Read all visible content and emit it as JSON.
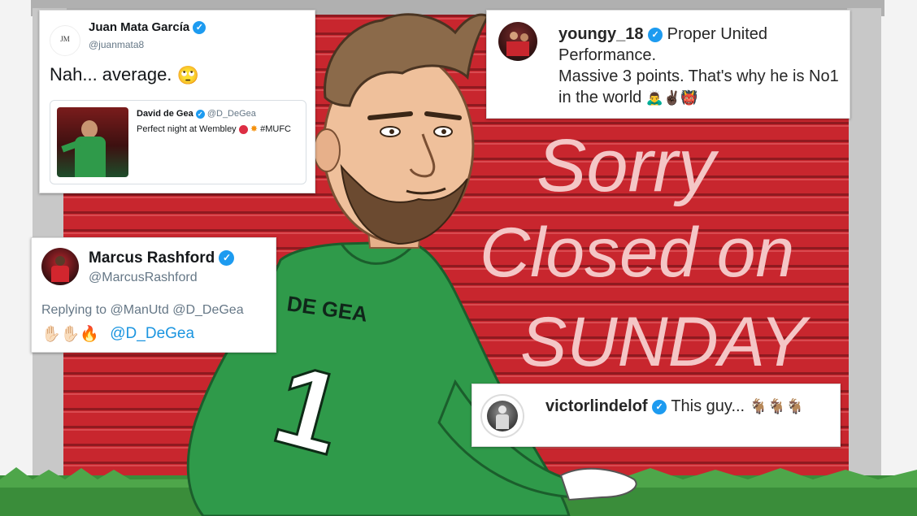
{
  "cards": {
    "mata": {
      "name": "Juan Mata García",
      "handle": "@juanmata8",
      "logo": "JM",
      "text": "Nah... average.",
      "emoji": "🙄",
      "quoted": {
        "name": "David de Gea",
        "handle": "@D_DeGea",
        "text": "Perfect night at Wembley",
        "hashtag": "#MUFC"
      }
    },
    "youngy": {
      "username": "youngy_18",
      "text_line1": "Proper United",
      "text_line2": "Performance.",
      "text_line3": "Massive 3 points. That's why he is No1",
      "text_line4": "in the world",
      "emojis": "🙇‍♂️✌🏿👹"
    },
    "rashford": {
      "name": "Marcus Rashford",
      "handle": "@MarcusRashford",
      "replying_prefix": "Replying to",
      "replying_to": "@ManUtd @D_DeGea",
      "emojis": "✋🏻✋🏻🔥",
      "mention": "@D_DeGea"
    },
    "lindelof": {
      "username": "victorlindelof",
      "text": "This guy...",
      "emojis": "🐐🐐🐐"
    }
  },
  "mural": {
    "shutter_text": [
      "Sorry",
      "Closed on",
      "SUNDAY"
    ],
    "shirt_name": "DE GEA",
    "shirt_number": "1"
  },
  "colors": {
    "shutter_red": "#c8262e",
    "shirt_green": "#2f9a4a",
    "verified_blue": "#1d9bf0"
  }
}
